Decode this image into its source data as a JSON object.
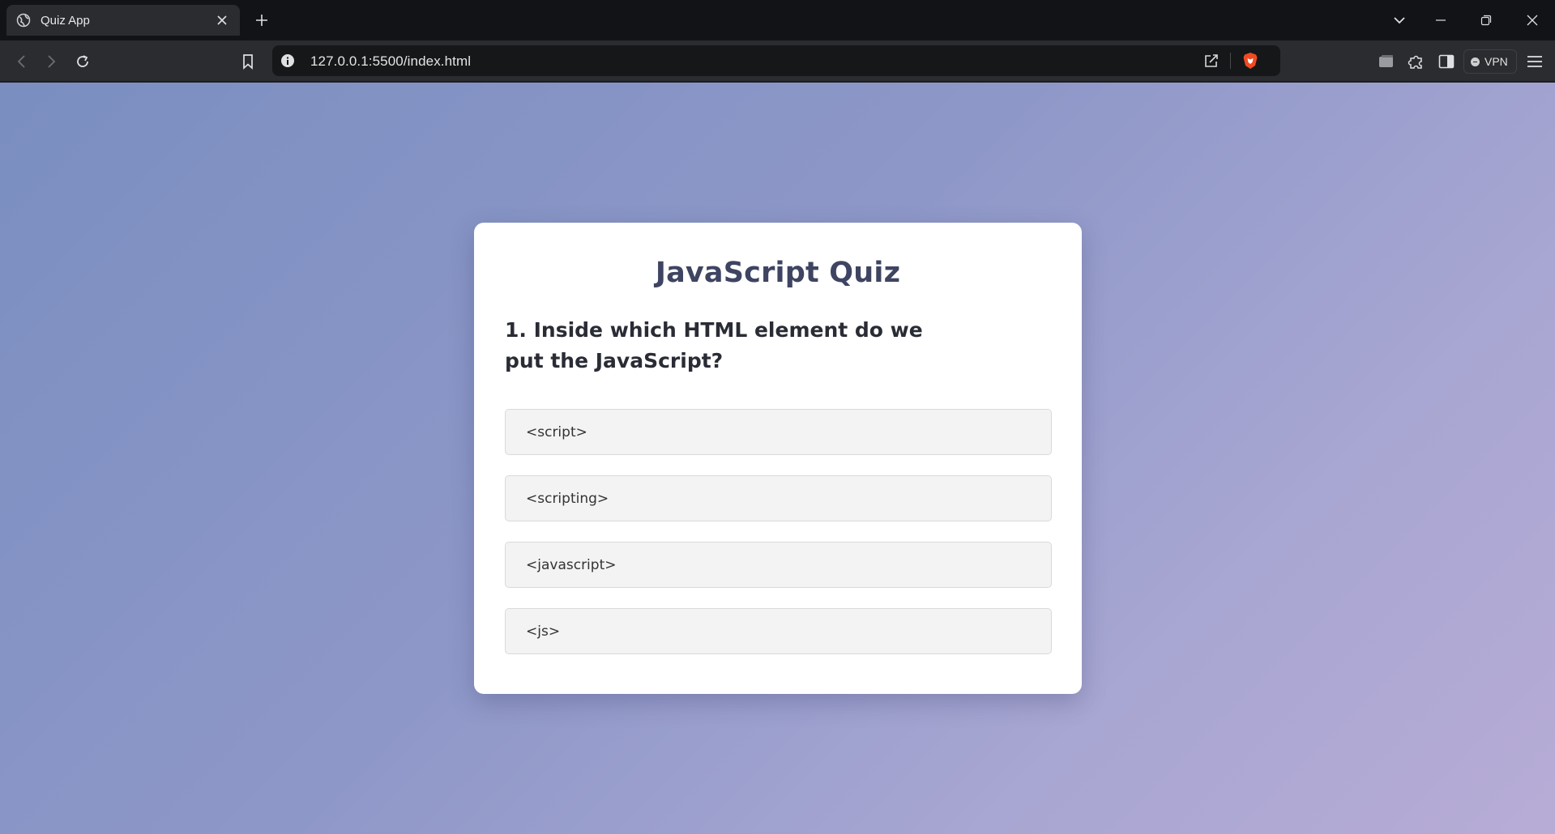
{
  "browser": {
    "tab": {
      "title": "Quiz App",
      "favicon": "globe-icon"
    },
    "url": "127.0.0.1:5500/index.html",
    "vpn_label": "VPN"
  },
  "quiz": {
    "title": "JavaScript Quiz",
    "question": "1. Inside which HTML element do we put the JavaScript?",
    "options": [
      "<script>",
      "<scripting>",
      "<javascript>",
      "<js>"
    ]
  },
  "colors": {
    "title": "#3e4461",
    "option_bg": "#f3f3f3",
    "gradient_start": "#7a8ec0",
    "gradient_end": "#b7acd6"
  }
}
